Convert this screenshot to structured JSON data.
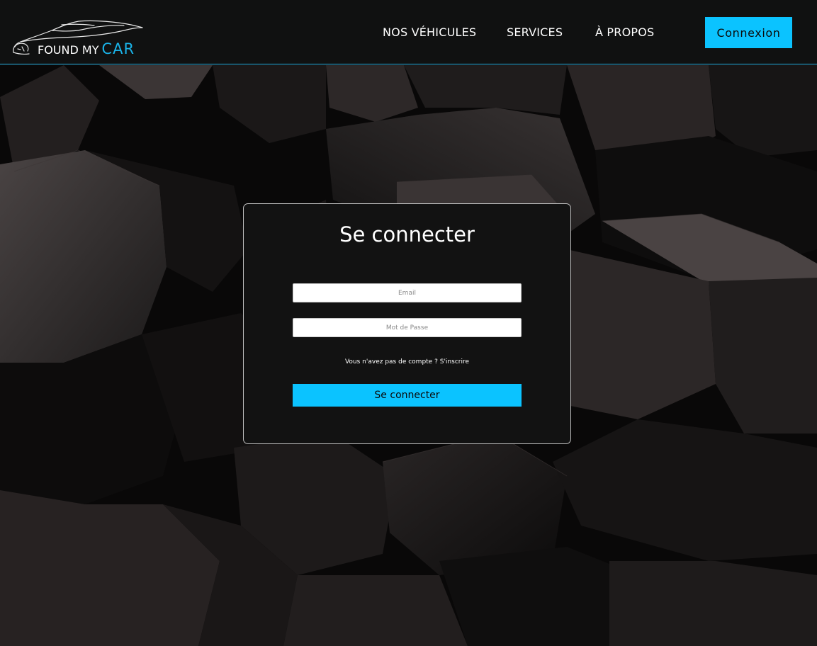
{
  "brand": {
    "name_prefix": "FOUND MY",
    "name_accent": "CAR",
    "accent_color": "#1ab3e8"
  },
  "nav": {
    "items": [
      {
        "label": "NOS VÉHICULES"
      },
      {
        "label": "SERVICES"
      },
      {
        "label": "À PROPOS"
      }
    ],
    "login_button": "Connexion"
  },
  "login": {
    "title": "Se connecter",
    "email_placeholder": "Email",
    "password_placeholder": "Mot de Passe",
    "signup_prompt": "Vous n'avez pas de compte ?",
    "signup_link": "S'inscrire",
    "submit_label": "Se connecter"
  },
  "colors": {
    "primary": "#0bc3ff",
    "header_bg": "#101111",
    "card_bg": "#121212"
  }
}
